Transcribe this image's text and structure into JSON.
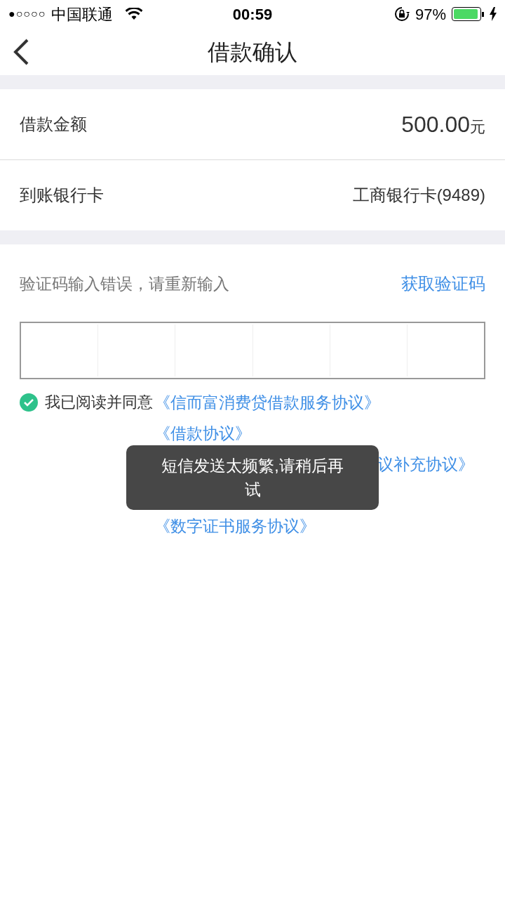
{
  "status_bar": {
    "signal": "●○○○○",
    "carrier": "中国联通",
    "time": "00:59",
    "battery": "97%"
  },
  "nav": {
    "title": "借款确认"
  },
  "rows": [
    {
      "label": "借款金额",
      "value": "500.00",
      "unit": "元"
    },
    {
      "label": "到账银行卡",
      "value": "工商银行卡(9489)"
    }
  ],
  "verify": {
    "message": "验证码输入错误，请重新输入",
    "get_code": "获取验证码"
  },
  "agreement": {
    "checked": true,
    "label": "我已阅读并同意",
    "links": [
      {
        "kind": "full",
        "text": "《信而富消费贷借款服务协议》"
      },
      {
        "kind": "full",
        "text": "《借款协议》"
      },
      {
        "kind": "cut",
        "text": "议补充协议》"
      },
      {
        "kind": "full",
        "text": "《数字证书服务协议》"
      }
    ]
  },
  "toast": {
    "message": "短信发送太频繁,请稍后再试"
  }
}
